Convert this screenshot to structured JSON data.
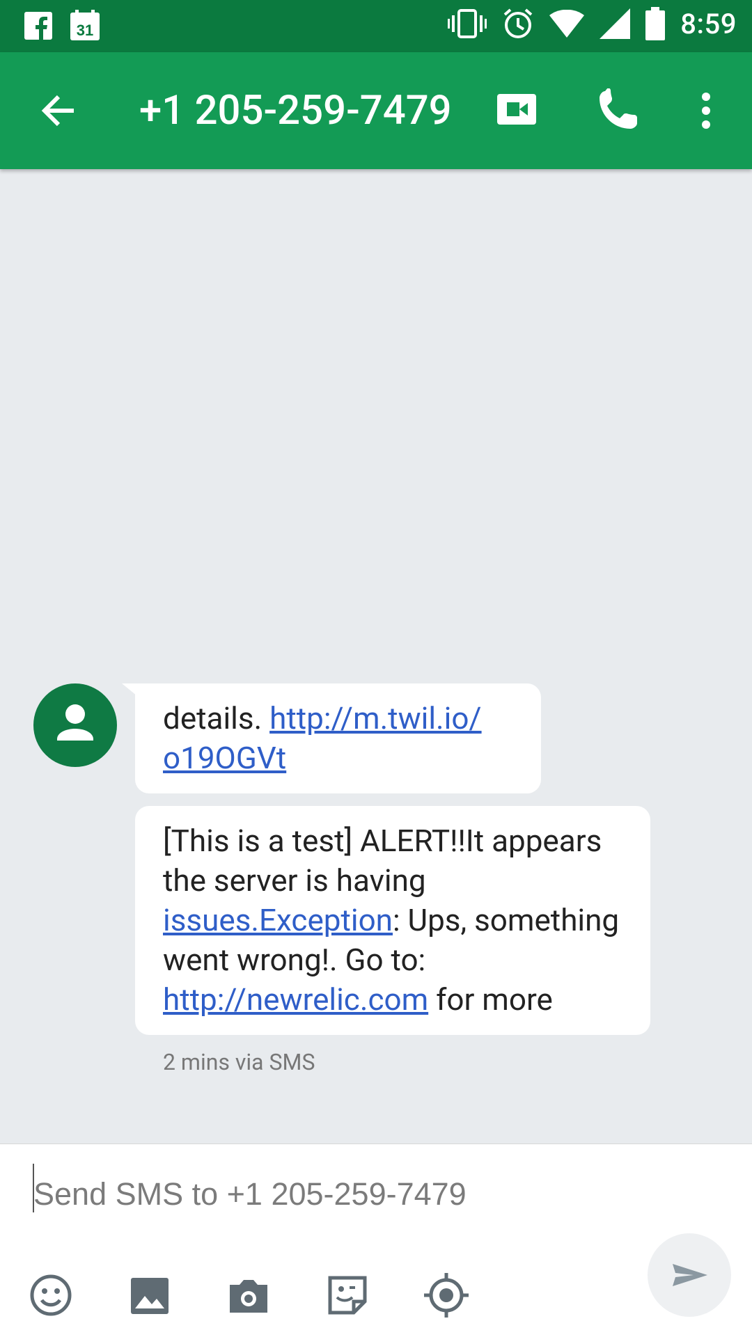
{
  "status_bar": {
    "time": "8:59",
    "left_icons": [
      "facebook-icon",
      "calendar-icon"
    ],
    "calendar_day": "31",
    "right_icons": [
      "vibrate-icon",
      "alarm-icon",
      "wifi-icon",
      "cell-signal-icon",
      "battery-icon"
    ]
  },
  "app_bar": {
    "title": "+1 205-259-7479",
    "actions": [
      "video-call-icon",
      "phone-icon",
      "more-vert-icon"
    ],
    "color": "#139b55"
  },
  "messages": [
    {
      "text_before": "details. ",
      "link": "http://m.twil.io/o19OGVt",
      "link_part1": "http://m.twil.io/",
      "link_part2": "o19OGVt"
    },
    {
      "text_1": "[This is a test] ALERT!!It appears the server is having ",
      "link_1": "issues.Exception",
      "text_2": ": Ups, something went wrong!. Go to: ",
      "link_2": "http://newrelic.com",
      "text_3": " for more"
    }
  ],
  "message_meta": "2 mins via SMS",
  "compose": {
    "placeholder": "Send SMS to +1 205-259-7479",
    "tools": [
      "emoji-icon",
      "gallery-icon",
      "camera-icon",
      "sticker-icon",
      "location-icon"
    ],
    "send": "send-icon"
  }
}
